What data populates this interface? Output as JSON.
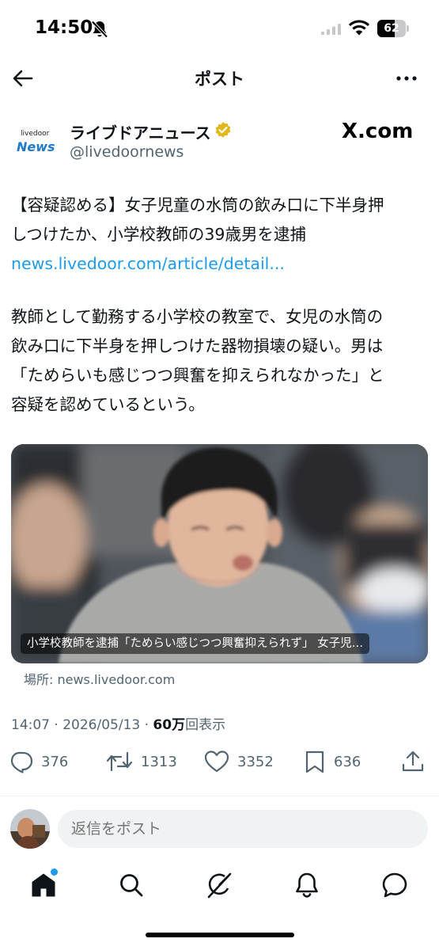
{
  "status_bar": {
    "time": "14:50",
    "battery_level": "62",
    "icons": [
      "bell-slash-icon",
      "cellular-signal-icon",
      "wifi-icon",
      "battery-icon"
    ]
  },
  "header": {
    "title": "ポスト",
    "icons": [
      "back-arrow-icon",
      "more-options-icon"
    ]
  },
  "author": {
    "name": "ライブドアニュース",
    "handle": "@livedoornews",
    "avatar_logo_small": "livedoor",
    "avatar_logo_big": "News",
    "source_logo": "X.com",
    "verified_color": "#e2b719"
  },
  "tweet": {
    "lines_1": [
      "【容疑認める】女子児童の水筒の飲み口に下半身押",
      "しつけたか、小学校教師の39歳男を逮捕"
    ],
    "link": "news.livedoor.com/article/detail...",
    "lines_2": [
      "教師として勤務する小学校の教室で、女児の水筒の",
      "飲み口に下半身を押しつけた器物損壊の疑い。男は",
      "「ためらいも感じつつ興奮を抑えられなかった」と",
      "容疑を認めているという。"
    ]
  },
  "card": {
    "caption": "小学校教師を逮捕「ためらい感じつつ興奮抑えられず」 女子児…",
    "source": "場所: news.livedoor.com"
  },
  "meta": {
    "time": "14:07",
    "separator": "·",
    "date": "2026/05/13",
    "views_count": "60万",
    "views_label": "回表示"
  },
  "actions": {
    "replies": "376",
    "reposts": "1313",
    "likes": "3352",
    "bookmarks": "636"
  },
  "reply_bar": {
    "placeholder": "返信をポスト"
  },
  "bottom_nav": {
    "items": [
      "home-icon",
      "search-icon",
      "grok-icon",
      "notifications-icon",
      "messages-icon"
    ],
    "accent": "#1d9bf0"
  }
}
